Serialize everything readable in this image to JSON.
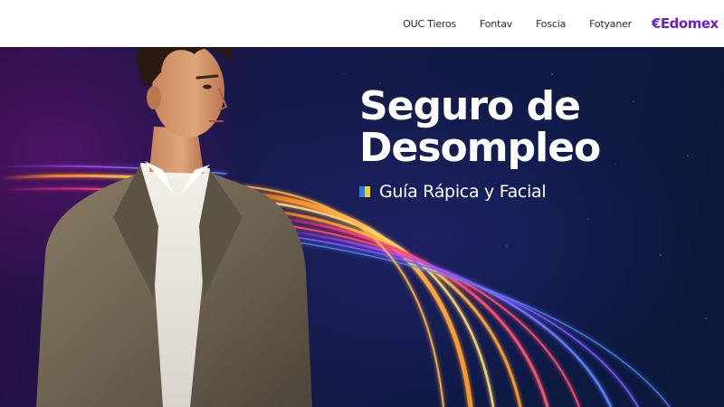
{
  "nav": {
    "items": [
      {
        "label": "OUC Tieros"
      },
      {
        "label": "Fontav"
      },
      {
        "label": "Foscia"
      },
      {
        "label": "Fotyaner"
      }
    ]
  },
  "brand": {
    "name": "€Edomex",
    "color": "#6a1fd1"
  },
  "hero": {
    "title_line1": "Seguro de",
    "title_line2": "Desompleo",
    "subtitle": "Guía Rápica y Facial",
    "bullet_colors": [
      "#2a7de1",
      "#f3d21c"
    ],
    "accent_colors": [
      "#ff8a1f",
      "#ff2e8a",
      "#a34dff",
      "#ffd36b"
    ]
  },
  "image": {
    "subject": "young-man-in-suit-photo"
  }
}
